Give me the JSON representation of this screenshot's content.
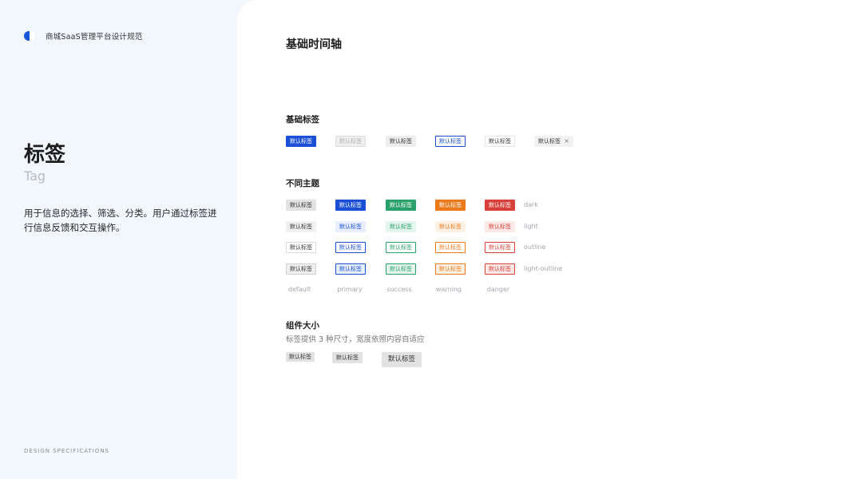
{
  "brand": {
    "logo_icon": "brand-logo-icon",
    "text": "商城SaaS管理平台设计规范"
  },
  "sidebar": {
    "title_cn": "标签",
    "title_en": "Tag",
    "description": "用于信息的选择、筛选、分类。用户通过标签进行信息反馈和交互操作。",
    "footer": "DESIGN SPECIFICATIONS"
  },
  "main": {
    "title": "基础时间轴",
    "basic": {
      "title": "基础标签",
      "tags": [
        "默认标签",
        "默认标签",
        "默认标签",
        "默认标签",
        "默认标签",
        "默认标签"
      ],
      "close_symbol": "×"
    },
    "themes": {
      "title": "不同主题",
      "tag_label": "默认标签",
      "row_labels": [
        "dark",
        "light",
        "outline",
        "light-outline"
      ],
      "col_labels": [
        "default",
        "primary",
        "success",
        "warning",
        "danger"
      ]
    },
    "sizes": {
      "title": "组件大小",
      "subtitle": "标签提供 3 种尺寸，宽度依照内容自适应",
      "tags": [
        "默认标签",
        "默认标签",
        "默认标签"
      ]
    }
  },
  "colors": {
    "primary": "#1a4fd6",
    "success": "#2aa06a",
    "warning": "#ec7a1a",
    "danger": "#d9403a",
    "sidebar_bg": "#f2f6fd"
  }
}
